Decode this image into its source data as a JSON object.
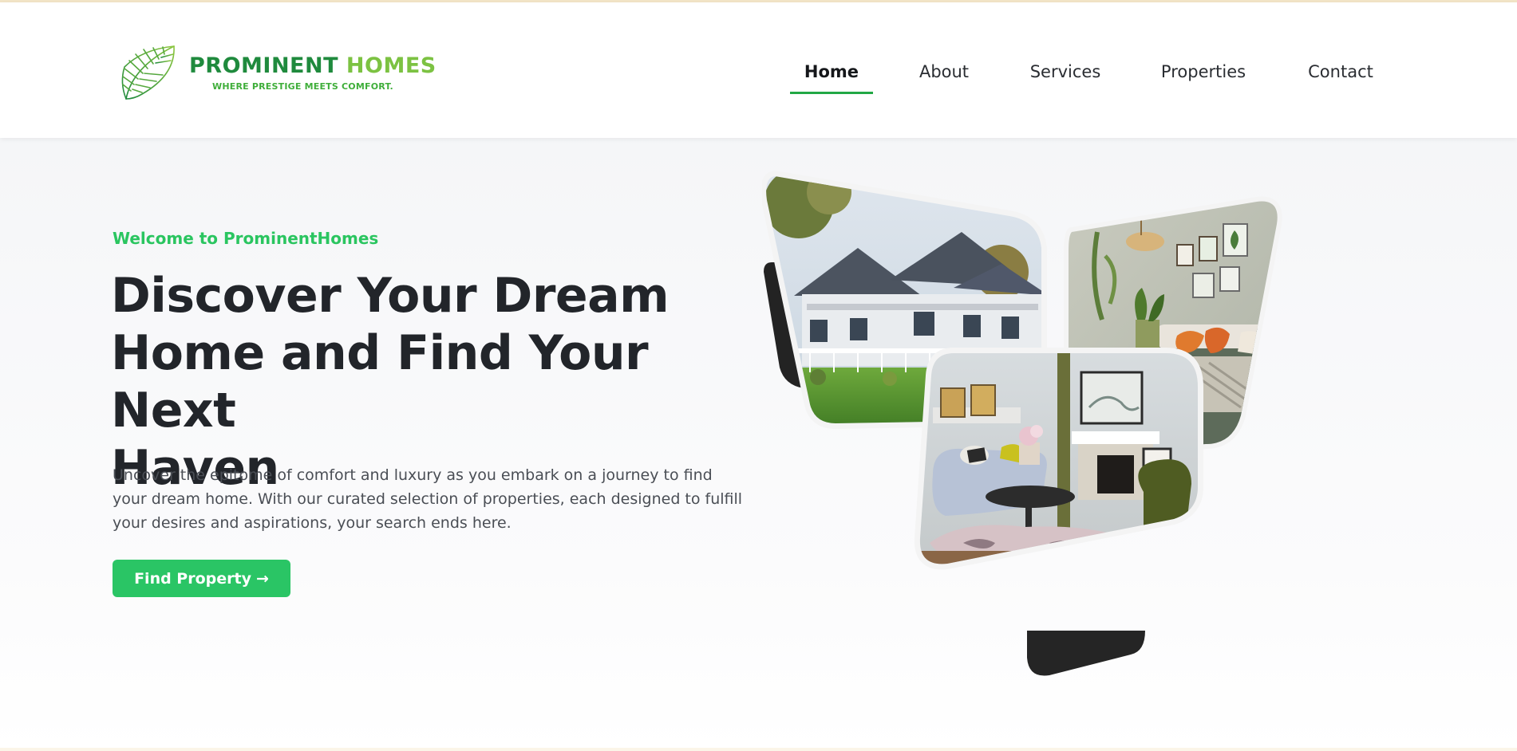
{
  "brand": {
    "name_part1": "PROMINENT",
    "name_part2": "HOMES",
    "tagline": "WHERE PRESTIGE MEETS COMFORT."
  },
  "nav": {
    "items": [
      {
        "label": "Home",
        "active": true
      },
      {
        "label": "About",
        "active": false
      },
      {
        "label": "Services",
        "active": false
      },
      {
        "label": "Properties",
        "active": false
      },
      {
        "label": "Contact",
        "active": false
      }
    ]
  },
  "hero": {
    "eyebrow": "Welcome to ProminentHomes",
    "headline_line1": "Discover Your Dream",
    "headline_line2": "Home and Find Your Next",
    "headline_line3": "Haven",
    "description": "Uncover the epitome of comfort and luxury as you embark on a journey to find your dream home. With our curated selection of properties, each designed to fulfill your desires and aspirations, your search ends here.",
    "cta_label": "Find Property",
    "cta_icon": "arrow-right-icon",
    "collage_images": [
      "house-exterior-photo",
      "bedroom-photo",
      "living-room-photo"
    ]
  },
  "colors": {
    "accent_green": "#2ac565",
    "nav_underline": "#22a845",
    "brand_dark_green": "#1f8a3d",
    "brand_light_green": "#7cc242",
    "heading": "#22252a",
    "body_text": "#4a4e55"
  }
}
